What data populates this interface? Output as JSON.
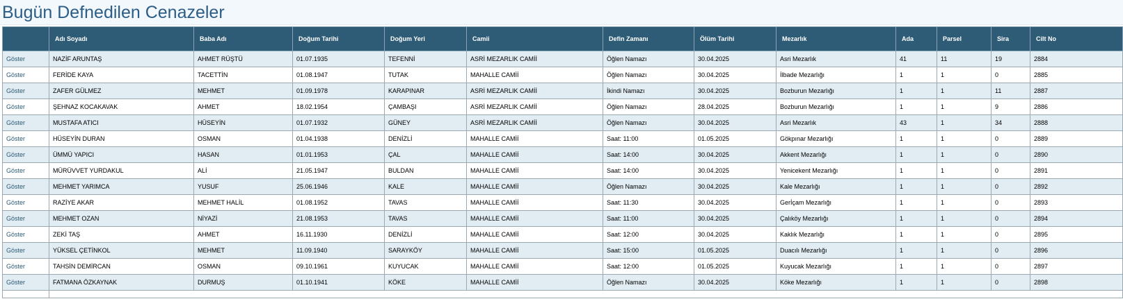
{
  "page": {
    "title": "Bugün Defnedilen Cenazeler"
  },
  "table": {
    "action_label": "Göster",
    "columns": [
      "",
      "Adı Soyadı",
      "Baba Adı",
      "Doğum Tarihi",
      "Doğum Yeri",
      "Camii",
      "Defin Zamanı",
      "Ölüm Tarihi",
      "Mezarlık",
      "Ada",
      "Parsel",
      "Sira",
      "Cilt No"
    ],
    "rows": [
      [
        "NAZİF ARUNTAŞ",
        "AHMET RÜŞTÜ",
        "01.07.1935",
        "TEFENNİ",
        "ASRİ MEZARLIK CAMİİ",
        "Öğlen Namazı",
        "30.04.2025",
        "Asri Mezarlık",
        "41",
        "11",
        "19",
        "2884"
      ],
      [
        "FERİDE KAYA",
        "TACETTİN",
        "01.08.1947",
        "TUTAK",
        "MAHALLE CAMİİ",
        "Öğlen Namazı",
        "30.04.2025",
        "İlbade Mezarlığı",
        "1",
        "1",
        "0",
        "2885"
      ],
      [
        "ZAFER GÜLMEZ",
        "MEHMET",
        "01.09.1978",
        "KARAPINAR",
        "ASRİ MEZARLIK CAMİİ",
        "İkindi Namazı",
        "30.04.2025",
        "Bozburun Mezarlığı",
        "1",
        "1",
        "11",
        "2887"
      ],
      [
        "ŞEHNAZ KOCAKAVAK",
        "AHMET",
        "18.02.1954",
        "ÇAMBAŞI",
        "ASRİ MEZARLIK CAMİİ",
        "Öğlen Namazı",
        "28.04.2025",
        "Bozburun Mezarlığı",
        "1",
        "1",
        "9",
        "2886"
      ],
      [
        "MUSTAFA ATICI",
        "HÜSEYİN",
        "01.07.1932",
        "GÜNEY",
        "ASRİ MEZARLIK CAMİİ",
        "Öğlen Namazı",
        "30.04.2025",
        "Asri Mezarlık",
        "43",
        "1",
        "34",
        "2888"
      ],
      [
        "HÜSEYİN DURAN",
        "OSMAN",
        "01.04.1938",
        "DENİZLİ",
        "MAHALLE CAMİİ",
        "Saat: 11:00",
        "01.05.2025",
        "Gökpınar Mezarlığı",
        "1",
        "1",
        "0",
        "2889"
      ],
      [
        "ÜMMÜ YAPICI",
        "HASAN",
        "01.01.1953",
        "ÇAL",
        "MAHALLE CAMİİ",
        "Saat: 14:00",
        "30.04.2025",
        "Akkent Mezarlığı",
        "1",
        "1",
        "0",
        "2890"
      ],
      [
        "MÜRÜVVET YURDAKUL",
        "ALİ",
        "21.05.1947",
        "BULDAN",
        "MAHALLE CAMİİ",
        "Saat: 14:00",
        "30.04.2025",
        "Yenicekent Mezarlığı",
        "1",
        "1",
        "0",
        "2891"
      ],
      [
        "MEHMET YARIMCA",
        "YUSUF",
        "25.06.1946",
        "KALE",
        "MAHALLE CAMİİ",
        "Öğlen Namazı",
        "30.04.2025",
        "Kale Mezarlığı",
        "1",
        "1",
        "0",
        "2892"
      ],
      [
        "RAZİYE AKAR",
        "MEHMET HALİL",
        "01.08.1952",
        "TAVAS",
        "MAHALLE CAMİİ",
        "Saat: 11:30",
        "30.04.2025",
        "Gerİçam Mezarlığı",
        "1",
        "1",
        "0",
        "2893"
      ],
      [
        "MEHMET OZAN",
        "NİYAZİ",
        "21.08.1953",
        "TAVAS",
        "MAHALLE CAMİİ",
        "Saat: 11:00",
        "30.04.2025",
        "Çalıköy Mezarlığı",
        "1",
        "1",
        "0",
        "2894"
      ],
      [
        "ZEKİ TAŞ",
        "AHMET",
        "16.11.1930",
        "DENİZLİ",
        "MAHALLE CAMİİ",
        "Saat: 12:00",
        "30.04.2025",
        "Kaklık Mezarlığı",
        "1",
        "1",
        "0",
        "2895"
      ],
      [
        "YÜKSEL ÇETİNKOL",
        "MEHMET",
        "11.09.1940",
        "SARAYKÖY",
        "MAHALLE CAMİİ",
        "Saat: 15:00",
        "01.05.2025",
        "Duacılı Mezarlığı",
        "1",
        "1",
        "0",
        "2896"
      ],
      [
        "TAHSİN DEMİRCAN",
        "OSMAN",
        "09.10.1961",
        "KUYUCAK",
        "MAHALLE CAMİİ",
        "Saat: 12:00",
        "01.05.2025",
        "Kuyucak Mezarlığı",
        "1",
        "1",
        "0",
        "2897"
      ],
      [
        "FATMANA ÖZKAYNAK",
        "DURMUŞ",
        "01.10.1941",
        "KÖKE",
        "MAHALLE CAMİİ",
        "Öğlen Namazı",
        "30.04.2025",
        "Köke Mezarlığı",
        "1",
        "1",
        "0",
        "2898"
      ]
    ]
  },
  "colors": {
    "header_bg": "#2e5c76",
    "row_alt": "#e2edf3",
    "title": "#2b5d86"
  }
}
